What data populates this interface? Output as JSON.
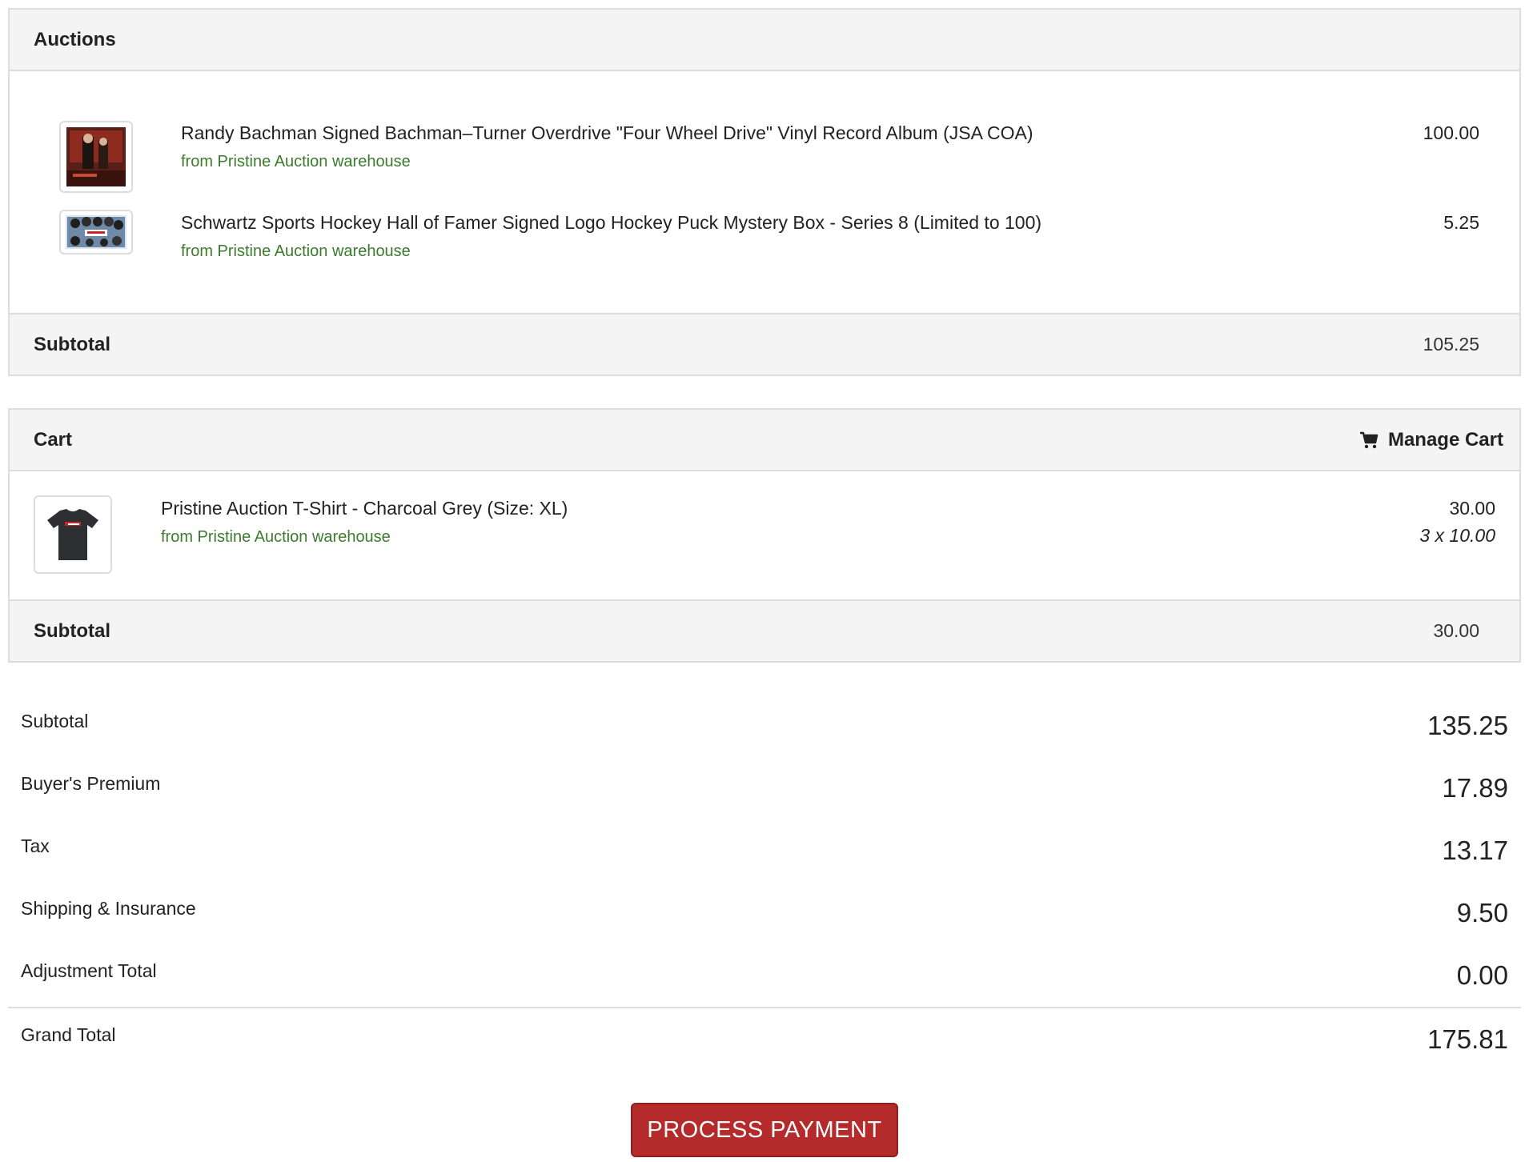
{
  "auctions": {
    "title": "Auctions",
    "items": [
      {
        "title": "Randy Bachman Signed Bachman–Turner Overdrive \"Four Wheel Drive\" Vinyl Record Album (JSA COA)",
        "from": "from Pristine Auction warehouse",
        "price": "100.00",
        "image": "vinyl-album-thumbnail"
      },
      {
        "title": "Schwartz Sports Hockey Hall of Famer Signed Logo Hockey Puck Mystery Box - Series 8 (Limited to 100)",
        "from": "from Pristine Auction warehouse",
        "price": "5.25",
        "image": "hockey-puck-box-thumbnail"
      }
    ],
    "subtotal_label": "Subtotal",
    "subtotal_value": "105.25"
  },
  "cart": {
    "title": "Cart",
    "manage_label": "Manage Cart",
    "manage_icon": "cart-icon",
    "items": [
      {
        "title": "Pristine Auction T-Shirt - Charcoal Grey (Size: XL)",
        "from": "from Pristine Auction warehouse",
        "price": "30.00",
        "qty": "3 x 10.00",
        "image": "tshirt-thumbnail"
      }
    ],
    "subtotal_label": "Subtotal",
    "subtotal_value": "30.00"
  },
  "totals": {
    "subtotal": {
      "label": "Subtotal",
      "value": "135.25"
    },
    "premium": {
      "label": "Buyer's Premium",
      "value": "17.89"
    },
    "tax": {
      "label": "Tax",
      "value": "13.17"
    },
    "shipping": {
      "label": "Shipping & Insurance",
      "value": "9.50"
    },
    "adjustment": {
      "label": "Adjustment Total",
      "value": "0.00"
    },
    "grand": {
      "label": "Grand Total",
      "value": "175.81"
    }
  },
  "actions": {
    "process_payment": "PROCESS PAYMENT"
  },
  "colors": {
    "accent_green": "#3c7a2e",
    "button_red": "#b52a2a",
    "panel_bg": "#f4f4f4",
    "border": "#dddddd"
  }
}
